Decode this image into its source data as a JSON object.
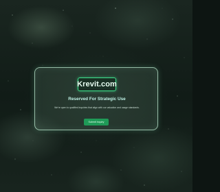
{
  "background": {
    "theme": "dark green starry space",
    "accent_color": "#3ee08c"
  },
  "domain_card": {
    "logo_text": "Krevit.com",
    "heading": "Reserved For Strategic Use",
    "description": "We're open to qualified inquiries that align with our valuation and usage standards.",
    "button_label": "Submit Inquiry",
    "button_color": "#1f9a57"
  }
}
